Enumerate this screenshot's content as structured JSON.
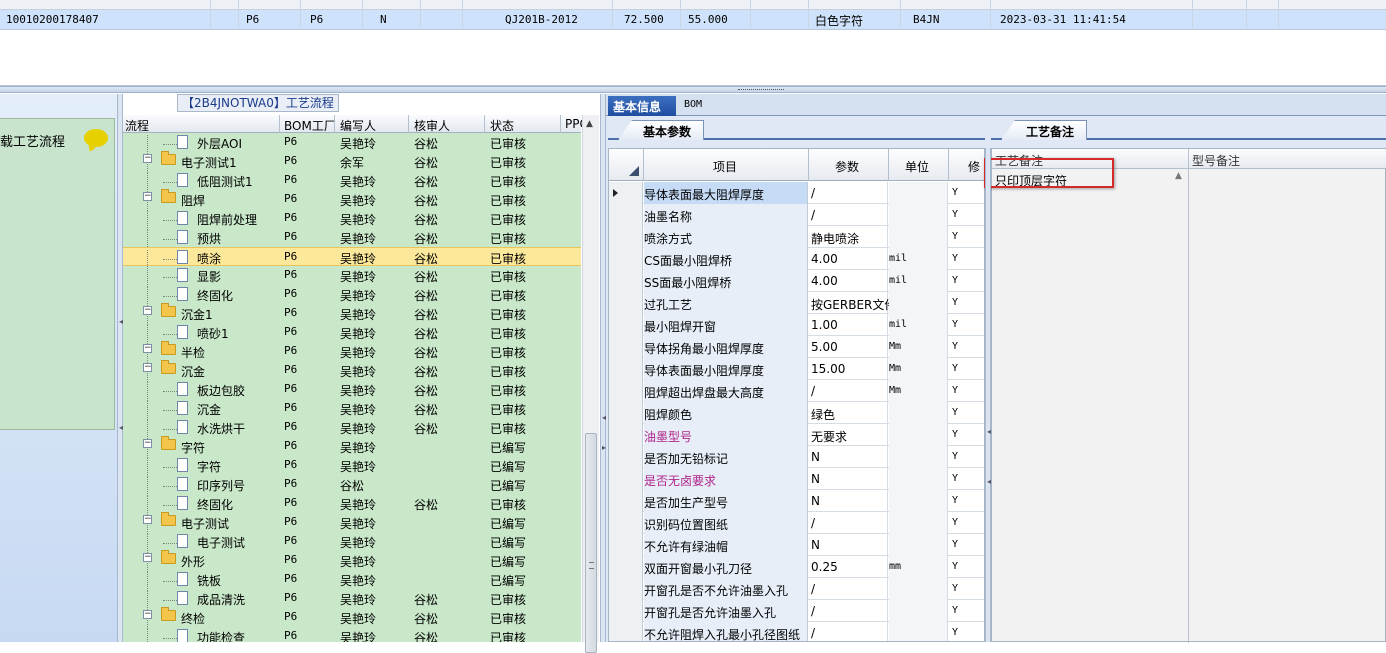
{
  "top_row": {
    "id": "10010200178407",
    "c1": "P6",
    "c2": "P6",
    "c3": "N",
    "std": "QJ201B-2012",
    "v1": "72.500",
    "v2": "55.000",
    "char_color": "白色字符",
    "code": "B4JN",
    "datetime": "2023-03-31 11:41:54"
  },
  "left_panel": {
    "title": "载工艺流程",
    "bubble_icon": "speech-bubble-icon"
  },
  "flow": {
    "caption": "【2B4JNOTWA0】工艺流程",
    "headers": [
      "流程",
      "BOM工厂",
      "编写人",
      "核审人",
      "状态",
      "PPC"
    ],
    "rows": [
      {
        "name": "外层AOI",
        "type": "doc",
        "level": 1,
        "bom": "P6",
        "author": "吴艳玲",
        "reviewer": "谷松",
        "status": "已审核"
      },
      {
        "name": "电子测试1",
        "type": "folder",
        "level": 0,
        "bom": "P6",
        "author": "余军",
        "reviewer": "谷松",
        "status": "已审核"
      },
      {
        "name": "低阻测试1",
        "type": "doc",
        "level": 1,
        "bom": "P6",
        "author": "吴艳玲",
        "reviewer": "谷松",
        "status": "已审核"
      },
      {
        "name": "阻焊",
        "type": "folder",
        "level": 0,
        "bom": "P6",
        "author": "吴艳玲",
        "reviewer": "谷松",
        "status": "已审核"
      },
      {
        "name": "阻焊前处理",
        "type": "doc",
        "level": 1,
        "bom": "P6",
        "author": "吴艳玲",
        "reviewer": "谷松",
        "status": "已审核"
      },
      {
        "name": "预烘",
        "type": "doc",
        "level": 1,
        "bom": "P6",
        "author": "吴艳玲",
        "reviewer": "谷松",
        "status": "已审核"
      },
      {
        "name": "喷涂",
        "type": "doc",
        "level": 1,
        "bom": "P6",
        "author": "吴艳玲",
        "reviewer": "谷松",
        "status": "已审核",
        "selected": true
      },
      {
        "name": "显影",
        "type": "doc",
        "level": 1,
        "bom": "P6",
        "author": "吴艳玲",
        "reviewer": "谷松",
        "status": "已审核"
      },
      {
        "name": "终固化",
        "type": "doc",
        "level": 1,
        "bom": "P6",
        "author": "吴艳玲",
        "reviewer": "谷松",
        "status": "已审核"
      },
      {
        "name": "沉金1",
        "type": "folder",
        "level": 0,
        "bom": "P6",
        "author": "吴艳玲",
        "reviewer": "谷松",
        "status": "已审核"
      },
      {
        "name": "喷砂1",
        "type": "doc",
        "level": 1,
        "bom": "P6",
        "author": "吴艳玲",
        "reviewer": "谷松",
        "status": "已审核"
      },
      {
        "name": "半检",
        "type": "folder",
        "level": 0,
        "bom": "P6",
        "author": "吴艳玲",
        "reviewer": "谷松",
        "status": "已审核"
      },
      {
        "name": "沉金",
        "type": "folder",
        "level": 0,
        "bom": "P6",
        "author": "吴艳玲",
        "reviewer": "谷松",
        "status": "已审核"
      },
      {
        "name": "板边包胶",
        "type": "doc",
        "level": 1,
        "bom": "P6",
        "author": "吴艳玲",
        "reviewer": "谷松",
        "status": "已审核"
      },
      {
        "name": "沉金",
        "type": "doc",
        "level": 1,
        "bom": "P6",
        "author": "吴艳玲",
        "reviewer": "谷松",
        "status": "已审核"
      },
      {
        "name": "水洗烘干",
        "type": "doc",
        "level": 1,
        "bom": "P6",
        "author": "吴艳玲",
        "reviewer": "谷松",
        "status": "已审核"
      },
      {
        "name": "字符",
        "type": "folder",
        "level": 0,
        "bom": "P6",
        "author": "吴艳玲",
        "reviewer": "",
        "status": "已编写"
      },
      {
        "name": "字符",
        "type": "doc",
        "level": 1,
        "bom": "P6",
        "author": "吴艳玲",
        "reviewer": "",
        "status": "已编写"
      },
      {
        "name": "印序列号",
        "type": "doc",
        "level": 1,
        "bom": "P6",
        "author": "谷松",
        "reviewer": "",
        "status": "已编写"
      },
      {
        "name": "终固化",
        "type": "doc",
        "level": 1,
        "bom": "P6",
        "author": "吴艳玲",
        "reviewer": "谷松",
        "status": "已审核"
      },
      {
        "name": "电子测试",
        "type": "folder",
        "level": 0,
        "bom": "P6",
        "author": "吴艳玲",
        "reviewer": "",
        "status": "已编写"
      },
      {
        "name": "电子测试",
        "type": "doc",
        "level": 1,
        "bom": "P6",
        "author": "吴艳玲",
        "reviewer": "",
        "status": "已编写"
      },
      {
        "name": "外形",
        "type": "folder",
        "level": 0,
        "bom": "P6",
        "author": "吴艳玲",
        "reviewer": "",
        "status": "已编写"
      },
      {
        "name": "铣板",
        "type": "doc",
        "level": 1,
        "bom": "P6",
        "author": "吴艳玲",
        "reviewer": "",
        "status": "已编写"
      },
      {
        "name": "成品清洗",
        "type": "doc",
        "level": 1,
        "bom": "P6",
        "author": "吴艳玲",
        "reviewer": "谷松",
        "status": "已审核"
      },
      {
        "name": "终检",
        "type": "folder",
        "level": 0,
        "bom": "P6",
        "author": "吴艳玲",
        "reviewer": "谷松",
        "status": "已审核"
      },
      {
        "name": "功能检查",
        "type": "doc",
        "level": 1,
        "bom": "P6",
        "author": "吴艳玲",
        "reviewer": "谷松",
        "status": "已审核"
      }
    ]
  },
  "right": {
    "tab_basic": "基本信息",
    "tab_bom": "BOM",
    "subtab_params": "基本参数",
    "subtab_notes": "工艺备注",
    "param_headers": [
      "项目",
      "参数",
      "单位",
      "修"
    ],
    "params": [
      {
        "item": "导体表面最大阻焊厚度",
        "value": "/",
        "unit": "",
        "flag": "Y",
        "current": true,
        "highlight": true
      },
      {
        "item": "油墨名称",
        "value": "/",
        "unit": "",
        "flag": "Y"
      },
      {
        "item": "喷涂方式",
        "value": "静电喷涂",
        "unit": "",
        "flag": "Y"
      },
      {
        "item": "CS面最小阻焊桥",
        "value": "4.00",
        "unit": "mil",
        "flag": "Y"
      },
      {
        "item": "SS面最小阻焊桥",
        "value": "4.00",
        "unit": "mil",
        "flag": "Y"
      },
      {
        "item": "过孔工艺",
        "value": "按GERBER文件",
        "unit": "",
        "flag": "Y"
      },
      {
        "item": "最小阻焊开窗",
        "value": "1.00",
        "unit": "mil",
        "flag": "Y"
      },
      {
        "item": "导体拐角最小阻焊厚度",
        "value": "5.00",
        "unit": "Μm",
        "flag": "Y"
      },
      {
        "item": "导体表面最小阻焊厚度",
        "value": "15.00",
        "unit": "Μm",
        "flag": "Y"
      },
      {
        "item": "阻焊超出焊盘最大高度",
        "value": "/",
        "unit": "Μm",
        "flag": "Y"
      },
      {
        "item": "阻焊颜色",
        "value": "绿色",
        "unit": "",
        "flag": "Y"
      },
      {
        "item": "油墨型号",
        "value": "无要求",
        "unit": "",
        "flag": "Y",
        "red": true
      },
      {
        "item": "是否加无铅标记",
        "value": "N",
        "unit": "",
        "flag": "Y"
      },
      {
        "item": "是否无卤要求",
        "value": "N",
        "unit": "",
        "flag": "Y",
        "red": true
      },
      {
        "item": "是否加生产型号",
        "value": "N",
        "unit": "",
        "flag": "Y"
      },
      {
        "item": "识别码位置图纸",
        "value": "/",
        "unit": "",
        "flag": "Y"
      },
      {
        "item": "不允许有绿油帽",
        "value": "N",
        "unit": "",
        "flag": "Y"
      },
      {
        "item": "双面开窗最小孔刀径",
        "value": "0.25",
        "unit": "mm",
        "flag": "Y"
      },
      {
        "item": "开窗孔是否不允许油墨入孔",
        "value": "/",
        "unit": "",
        "flag": "Y"
      },
      {
        "item": "开窗孔是否允许油墨入孔",
        "value": "/",
        "unit": "",
        "flag": "Y"
      },
      {
        "item": "不允许阻焊入孔最小孔径图纸",
        "value": "/",
        "unit": "",
        "flag": "Y"
      }
    ],
    "notes_headers": [
      "工艺备注",
      "型号备注"
    ],
    "process_note": "只印顶层字符"
  }
}
